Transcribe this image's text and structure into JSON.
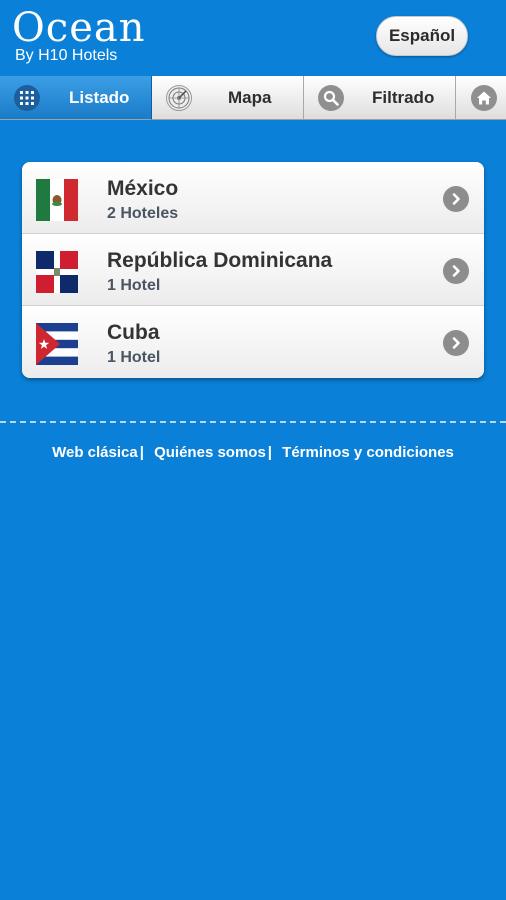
{
  "header": {
    "logo_main": "Ocean",
    "logo_sub": "By H10 Hotels",
    "language_button": "Español"
  },
  "tabs": [
    {
      "label": "Listado",
      "icon": "grid-icon",
      "active": true
    },
    {
      "label": "Mapa",
      "icon": "radar-icon",
      "active": false
    },
    {
      "label": "Filtrado",
      "icon": "search-icon",
      "active": false
    },
    {
      "label": "",
      "icon": "home-icon",
      "active": false
    }
  ],
  "countries": [
    {
      "name": "México",
      "count": "2 Hoteles",
      "flag": "mexico-flag"
    },
    {
      "name": "República Dominicana",
      "count": "1 Hotel",
      "flag": "dominican-republic-flag"
    },
    {
      "name": "Cuba",
      "count": "1 Hotel",
      "flag": "cuba-flag"
    }
  ],
  "footer": {
    "link1": "Web clásica",
    "link2": "Quiénes somos",
    "link3": "Términos y condiciones",
    "separator": "|"
  },
  "colors": {
    "background": "#0a80d8",
    "active_tab": "#1a7cc8",
    "chevron": "#8d8d8d"
  }
}
